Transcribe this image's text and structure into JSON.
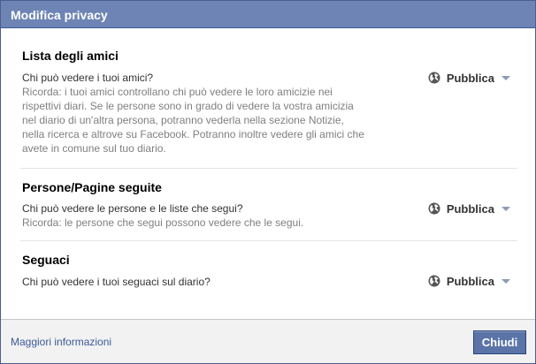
{
  "dialog": {
    "title": "Modifica privacy"
  },
  "sections": [
    {
      "title": "Lista degli amici",
      "question": "Chi può vedere i tuoi amici?",
      "note_lines": [
        "Ricorda: i tuoi amici controllano chi può vedere le loro amicizie nei",
        "rispettivi diari. Se le persone sono in grado di vedere la vostra amicizia",
        "nel diario di un'altra persona, potranno vederla nella sezione Notizie,",
        "nella ricerca e altrove su Facebook. Potranno inoltre vedere gli amici che",
        "avete in comune sul tuo diario."
      ],
      "audience": "Pubblica",
      "audience_icon": "globe-icon"
    },
    {
      "title": "Persone/Pagine seguite",
      "question": "Chi può vedere le persone e le liste che segui?",
      "note_lines": [
        "Ricorda: le persone che segui possono vedere che le segui."
      ],
      "audience": "Pubblica",
      "audience_icon": "globe-icon"
    },
    {
      "title": "Seguaci",
      "question": "Chi può vedere i tuoi seguaci sul diario?",
      "note_lines": [],
      "audience": "Pubblica",
      "audience_icon": "globe-icon"
    }
  ],
  "footer": {
    "link_label": "Maggiori informazioni",
    "close_label": "Chiudi"
  },
  "colors": {
    "titlebar": "#6d84b4",
    "link": "#3b5998",
    "button": "#5b74a8",
    "note_text": "#7f7f7f"
  }
}
